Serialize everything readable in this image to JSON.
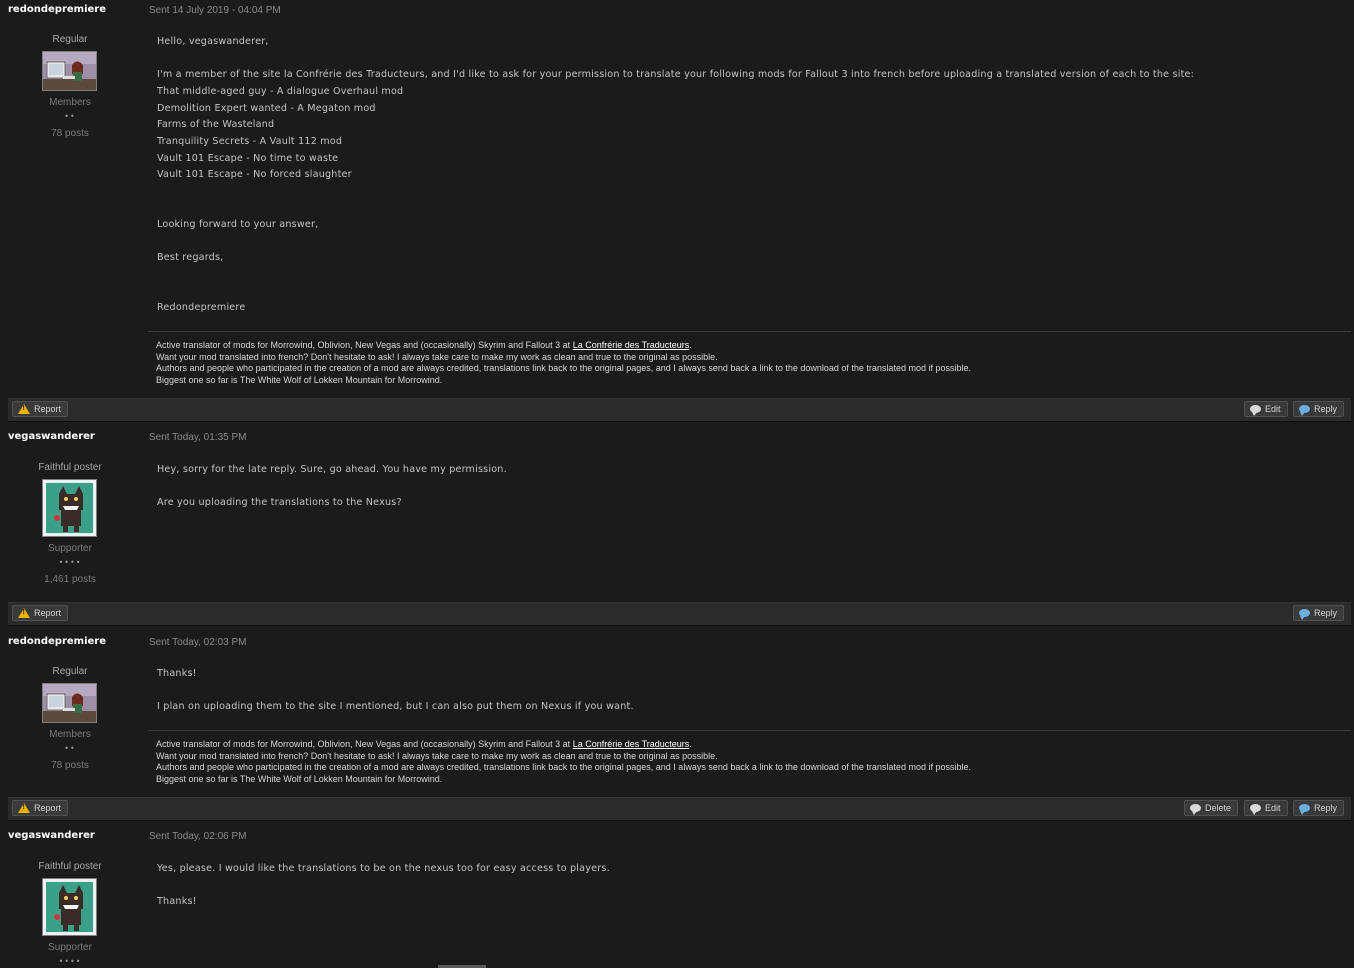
{
  "signature": {
    "line1_prefix": "Active translator of mods for Morrowind, Oblivion, New Vegas and (occasionally) Skyrim and Fallout 3 at ",
    "line1_link": "La Confrérie des Traducteurs",
    "line1_suffix": ".",
    "line2": "Want your mod translated into french? Don't hesitate to ask! I always take care to make my work as clean and true to the original as possible.",
    "line3": "Authors and people who participated in the creation of a mod are always credited, translations link back to the original pages, and I always send back a link to the download of the translated mod if possible.",
    "line4": "Biggest one so far is The White Wolf of Lokken Mountain for Morrowind."
  },
  "buttons": {
    "report": "Report",
    "edit": "Edit",
    "reply": "Reply",
    "delete": "Delete"
  },
  "posts": [
    {
      "author": "redondepremiere",
      "date": "Sent 14 July 2019 - 04:04 PM",
      "rank": "Regular",
      "group": "Members",
      "pips": "••",
      "postcount": "78 posts",
      "lines": [
        "Hello, vegaswanderer,",
        "I'm a member of the site la Confrérie des Traducteurs, and I'd like to ask for your permission to translate your following mods for Fallout 3 into french before uploading a translated version of each to the site:",
        "That middle-aged guy - A dialogue Overhaul mod",
        "Demolition Expert wanted - A Megaton mod",
        "Farms of the Wasteland",
        "Tranquility Secrets - A Vault 112 mod",
        "Vault 101 Escape - No time to waste",
        "Vault 101 Escape - No forced slaughter",
        "Looking forward to your answer,",
        "Best regards,",
        "Redondepremiere"
      ]
    },
    {
      "author": "vegaswanderer",
      "date": "Sent Today, 01:35 PM",
      "rank": "Faithful poster",
      "group": "Supporter",
      "pips": "••••",
      "postcount": "1,461 posts",
      "lines": [
        "Hey, sorry for the late reply. Sure, go ahead. You have my permission.",
        "Are you uploading the translations to the Nexus?"
      ]
    },
    {
      "author": "redondepremiere",
      "date": "Sent Today, 02:03 PM",
      "rank": "Regular",
      "group": "Members",
      "pips": "••",
      "postcount": "78 posts",
      "lines": [
        "Thanks!",
        "I plan on uploading them to the site I mentioned, but I can also put them on Nexus if you want."
      ]
    },
    {
      "author": "vegaswanderer",
      "date": "Sent Today, 02:06 PM",
      "rank": "Faithful poster",
      "group": "Supporter",
      "pips": "••••",
      "lines": [
        "Yes, please. I would like the translations to be on the nexus too for easy access to players.",
        "Thanks!"
      ]
    }
  ]
}
